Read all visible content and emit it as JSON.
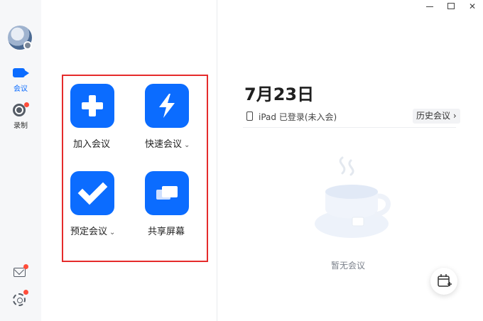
{
  "nav": {
    "meeting_label": "会议",
    "record_label": "录制"
  },
  "actions": {
    "join": {
      "label": "加入会议",
      "icon": "plus-icon"
    },
    "quick": {
      "label": "快速会议",
      "icon": "bolt-icon"
    },
    "schedule": {
      "label": "预定会议",
      "icon": "check-icon"
    },
    "share": {
      "label": "共享屏幕",
      "icon": "share-screen-icon"
    }
  },
  "right": {
    "date": "7月23日",
    "status": "iPad 已登录(未入会)",
    "history_label": "历史会议",
    "empty_text": "暂无会议"
  },
  "colors": {
    "accent": "#0b6cff",
    "highlight_border": "#e52b2b",
    "badge": "#ff4d3a"
  }
}
